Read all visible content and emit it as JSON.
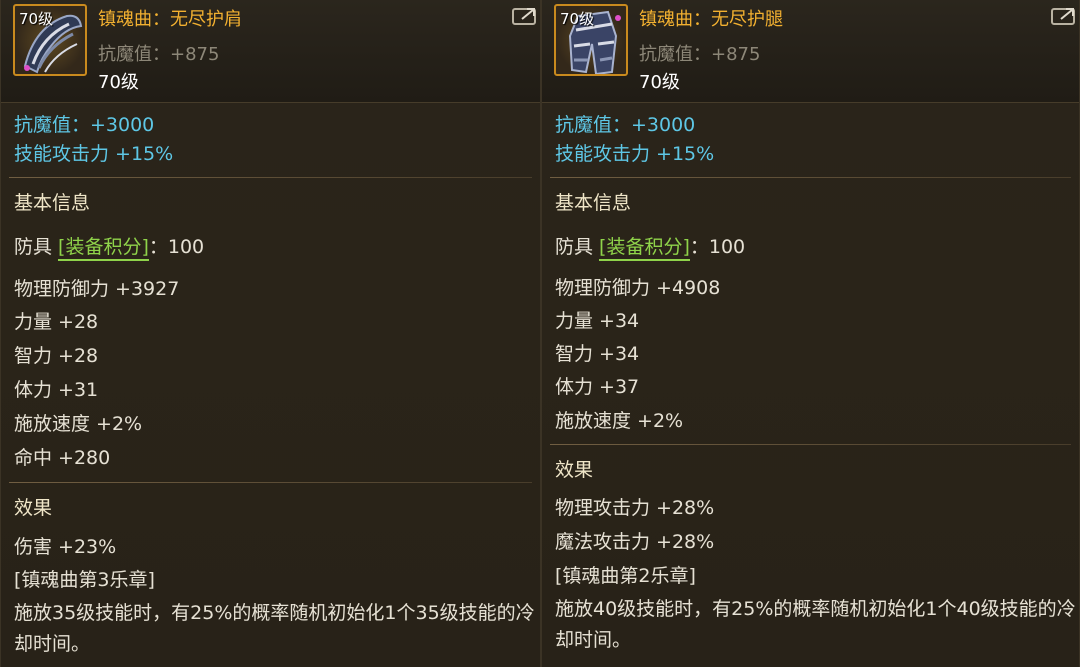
{
  "panels": [
    {
      "level_badge": "70级",
      "name": "镇魂曲：无尽护肩",
      "sub_stat": "抗魔值：+875",
      "sub_level": "70级",
      "magic_resist": "抗魔值：+3000",
      "skill_attack": "技能攻击力 +15%",
      "basic_info_heading": "基本信息",
      "armor_prefix": "防具 ",
      "armor_tag": "[装备积分]",
      "armor_value": "：100",
      "stats": [
        "物理防御力 +3927",
        "力量 +28",
        "智力 +28",
        "体力 +31",
        "施放速度 +2%",
        "命中 +280"
      ],
      "effect_heading": "效果",
      "effects": [
        "伤害 +23%"
      ],
      "movement": "[镇魂曲第3乐章]",
      "description": "施放35级技能时，有25%的概率随机初始化1个35级技能的冷却时间。"
    },
    {
      "level_badge": "70级",
      "name": "镇魂曲：无尽护腿",
      "sub_stat": "抗魔值：+875",
      "sub_level": "70级",
      "magic_resist": "抗魔值：+3000",
      "skill_attack": "技能攻击力 +15%",
      "basic_info_heading": "基本信息",
      "armor_prefix": "防具 ",
      "armor_tag": "[装备积分]",
      "armor_value": "：100",
      "stats": [
        "物理防御力 +4908",
        "力量 +34",
        "智力 +34",
        "体力 +37",
        "施放速度 +2%"
      ],
      "effect_heading": "效果",
      "effects": [
        "物理攻击力 +28%",
        "魔法攻击力 +28%"
      ],
      "movement": "[镇魂曲第2乐章]",
      "description": "施放40级技能时，有25%的概率随机初始化1个40级技能的冷却时间。"
    }
  ],
  "colors": {
    "name": "#f2b030",
    "blue_stat": "#5ec7e6",
    "green_tag": "#8fd34a",
    "white_text": "#e6e1d4",
    "icon_border": "#c98a1e"
  },
  "icons": [
    "shoulder-armor-icon",
    "leg-armor-icon",
    "share-icon"
  ]
}
